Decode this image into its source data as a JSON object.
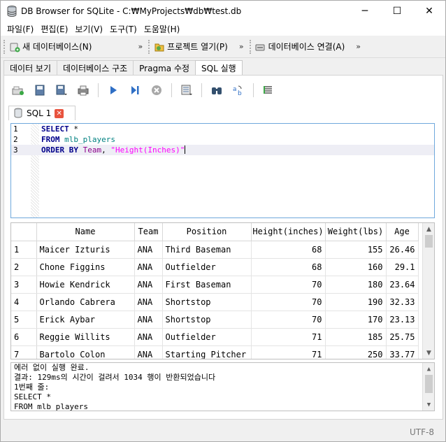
{
  "window": {
    "title": "DB Browser for SQLite - C:₩MyProjects₩db₩test.db",
    "minimize": "─",
    "maximize": "☐",
    "close": "✕"
  },
  "menu": [
    "파일(F)",
    "편집(E)",
    "보기(V)",
    "도구(T)",
    "도움말(H)"
  ],
  "toolbar": {
    "new_db": "새 데이터베이스(N)",
    "open_project": "프로젝트 열기(P)",
    "db_connect": "데이터베이스 연결(A)",
    "ext": "»"
  },
  "tabs": [
    "데이터 보기",
    "데이터베이스 구조",
    "Pragma 수정",
    "SQL 실행"
  ],
  "active_tab": "SQL 실행",
  "sql_tab": {
    "label": "SQL 1",
    "close": "✕"
  },
  "editor": {
    "line_numbers": [
      "1",
      "2",
      "3"
    ],
    "line1": {
      "kw1": "SELECT",
      "rest": " *"
    },
    "line2": {
      "kw": "FROM",
      "table": "mlb_players"
    },
    "line3": {
      "kw": "ORDER BY",
      "ident": "Team",
      "sep": ", ",
      "str": "\"Height(Inches)\""
    }
  },
  "results": {
    "columns": [
      "Name",
      "Team",
      "Position",
      "Height(inches)",
      "Weight(lbs)",
      "Age"
    ],
    "rows": [
      {
        "n": "1",
        "name": "Maicer Izturis",
        "team": "ANA",
        "pos": "Third Baseman",
        "h": "68",
        "w": "155",
        "age": "26.46"
      },
      {
        "n": "2",
        "name": "Chone Figgins",
        "team": "ANA",
        "pos": "Outfielder",
        "h": "68",
        "w": "160",
        "age": "29.1"
      },
      {
        "n": "3",
        "name": "Howie Kendrick",
        "team": "ANA",
        "pos": "First Baseman",
        "h": "70",
        "w": "180",
        "age": "23.64"
      },
      {
        "n": "4",
        "name": "Orlando Cabrera",
        "team": "ANA",
        "pos": "Shortstop",
        "h": "70",
        "w": "190",
        "age": "32.33"
      },
      {
        "n": "5",
        "name": "Erick Aybar",
        "team": "ANA",
        "pos": "Shortstop",
        "h": "70",
        "w": "170",
        "age": "23.13"
      },
      {
        "n": "6",
        "name": "Reggie Willits",
        "team": "ANA",
        "pos": "Outfielder",
        "h": "71",
        "w": "185",
        "age": "25.75"
      },
      {
        "n": "7",
        "name": "Bartolo Colon",
        "team": "ANA",
        "pos": "Starting Pitcher",
        "h": "71",
        "w": "250",
        "age": "33.77"
      }
    ]
  },
  "messages": [
    "에러 없이 실행 완료.",
    "결과: 129ms의 시간이 걸려서 1034 행이 반환되었습니다",
    "1번째 줄:",
    "SELECT *",
    "FROM mlb_players"
  ],
  "status": {
    "encoding": "UTF-8"
  },
  "scroll": {
    "up": "▲",
    "down": "▼"
  },
  "colors": {
    "accent": "#6fa8dc",
    "close_red": "#e8533e",
    "keyword": "#00008b",
    "string": "#ff00ff"
  }
}
